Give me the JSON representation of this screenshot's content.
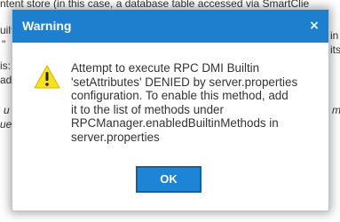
{
  "background": {
    "lines": [
      "ntent store (in this case, a database table accessed via SmartClie",
      "uilt",
      "\"",
      "is:",
      "ad",
      "u",
      "ue",
      "m",
      "in",
      "its"
    ]
  },
  "dialog": {
    "title": "Warning",
    "close_label": "×",
    "message_lines": [
      "Attempt to execute RPC DMI Builtin",
      "'setAttributes' DENIED by server.properties",
      "configuration.  To enable this method, add",
      "it to the list of methods under",
      "RPCManager.enabledBuiltinMethods in",
      "server.properties"
    ],
    "ok_label": "OK",
    "icon": "warning-triangle-icon"
  },
  "colors": {
    "titlebar": "#1f7fcf",
    "ok_button": "#1d84d6",
    "warning_yellow": "#f7e21b"
  }
}
